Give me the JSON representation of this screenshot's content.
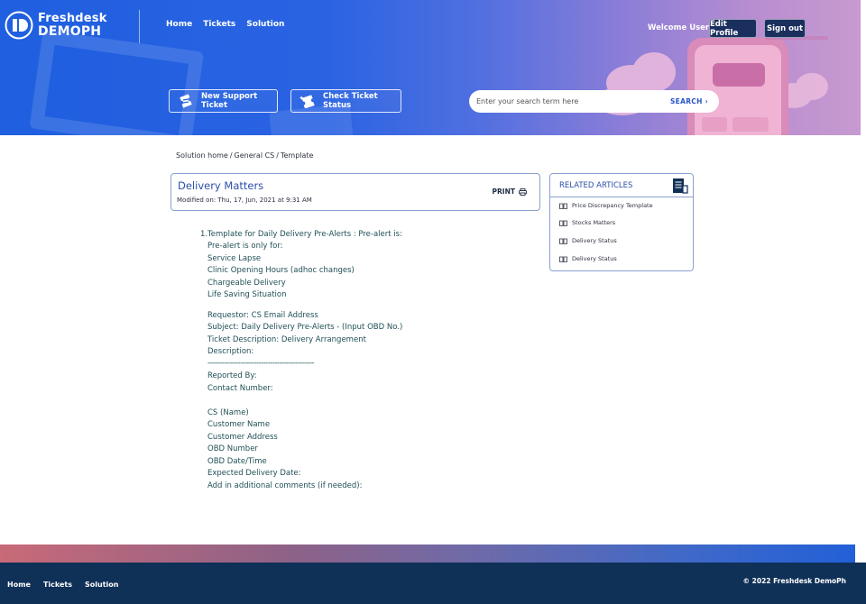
{
  "header": {
    "logo": {
      "line1": "Freshdesk",
      "line2_a": "DEMO",
      "line2_b": "PH"
    },
    "nav": [
      "Home",
      "Tickets",
      "Solution"
    ],
    "welcome": "Welcome User",
    "edit_profile": "Edit Profile",
    "sign_out": "Sign out",
    "new_ticket": "New Support Ticket",
    "check_status": "Check Ticket Status",
    "search": {
      "placeholder": "Enter your search term here",
      "button": "SEARCH"
    }
  },
  "breadcrumb": [
    "Solution home",
    "General CS",
    "Template"
  ],
  "article": {
    "title": "Delivery Matters",
    "modified": "Modified on: Thu, 17, Jun, 2021 at 9:31 AM",
    "print": "PRINT",
    "list_number": "1.",
    "lines": [
      "Template for Daily Delivery Pre-Alerts :   Pre-alert is:",
      "Pre-alert is only for:",
      "Service Lapse",
      "Clinic Opening Hours (adhoc changes)",
      "Chargeable Delivery",
      "Life Saving Situation",
      "Requestor:  CS Email Address",
      "Subject: Daily Delivery Pre-Alerts - (Input OBD No.)",
      "Ticket Description: Delivery Arrangement",
      "Description:",
      "----------------------------------------------",
      "Reported By:",
      "Contact Number:",
      "CS (Name)",
      "Customer Name",
      "Customer Address",
      "OBD Number",
      "OBD Date/Time",
      "Expected Delivery Date:",
      "Add in additional comments (if needed):"
    ]
  },
  "related": {
    "title": "RELATED ARTICLES",
    "items": [
      "Price Discrepancy Template",
      "Stocks Matters",
      "Delivery Status",
      "Delivery Status"
    ]
  },
  "footer": {
    "nav": [
      "Home",
      "Tickets",
      "Solution"
    ],
    "copyright": "© 2022 Freshdesk DemoPh"
  },
  "colors": {
    "brand_blue": "#1f5fe0",
    "navy": "#0f3057",
    "link_blue": "#2a4fa8",
    "body_teal": "#1f4f56"
  }
}
